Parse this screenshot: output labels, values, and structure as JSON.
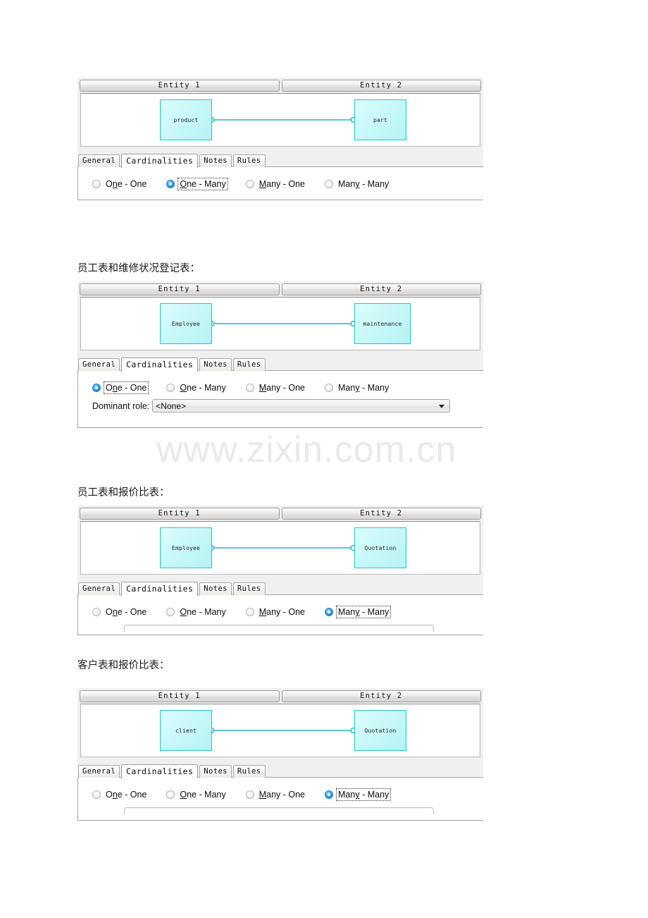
{
  "watermark": {
    "text": "www.zixin.com.cn"
  },
  "entity_headers": {
    "left": "Entity 1",
    "right": "Entity 2"
  },
  "tabs": [
    {
      "label": "General",
      "active": false
    },
    {
      "label": "Cardinalities",
      "active": true
    },
    {
      "label": "Notes",
      "active": false
    },
    {
      "label": "Rules",
      "active": false
    }
  ],
  "cardinality_options": [
    {
      "id": "one-one",
      "pre": "O",
      "mnemonic": "n",
      "post": "e - One"
    },
    {
      "id": "one-many",
      "pre": "",
      "mnemonic": "O",
      "post": "ne - Many"
    },
    {
      "id": "many-one",
      "pre": "",
      "mnemonic": "M",
      "post": "any - One"
    },
    {
      "id": "many-many",
      "pre": "Man",
      "mnemonic": "y",
      "post": " - Many"
    }
  ],
  "dominant_role": {
    "label": "Dominant role:",
    "value": "<None>"
  },
  "panels": [
    {
      "caption": "",
      "left_entity": "product",
      "right_entity": "part",
      "left_crowfoot": false,
      "right_crowfoot": true,
      "selected_cardinality": "one-many",
      "show_dominant_role": false,
      "show_partial_widget": false
    },
    {
      "caption": "员工表和维修状况登记表：",
      "left_entity": "Employee",
      "right_entity": "maintenance",
      "left_crowfoot": false,
      "right_crowfoot": false,
      "selected_cardinality": "one-one",
      "show_dominant_role": true,
      "show_partial_widget": false
    },
    {
      "caption": "员工表和报价比表：",
      "left_entity": "Employee",
      "right_entity": "Quotation",
      "left_crowfoot": true,
      "right_crowfoot": true,
      "selected_cardinality": "many-many",
      "show_dominant_role": false,
      "show_partial_widget": true
    },
    {
      "caption": "客户表和报价比表：",
      "left_entity": "client",
      "right_entity": "Quotation",
      "left_crowfoot": true,
      "right_crowfoot": true,
      "selected_cardinality": "many-many",
      "show_dominant_role": false,
      "show_partial_widget": true
    }
  ],
  "colors": {
    "entity_border": "#24c4c8",
    "entity_fill": "#c6f7f8",
    "connector": "#1fb9bd",
    "radio_selected": "#0a6bbd",
    "watermark": "#e9e9e9"
  },
  "layout": {
    "panel_tops": [
      110,
      399,
      717,
      976
    ],
    "panel_heights": [
      198,
      227,
      185,
      185
    ],
    "caption_tops": [
      0,
      369,
      687,
      932
    ],
    "tabbody_heights": [
      48,
      82,
      58,
      62
    ]
  }
}
